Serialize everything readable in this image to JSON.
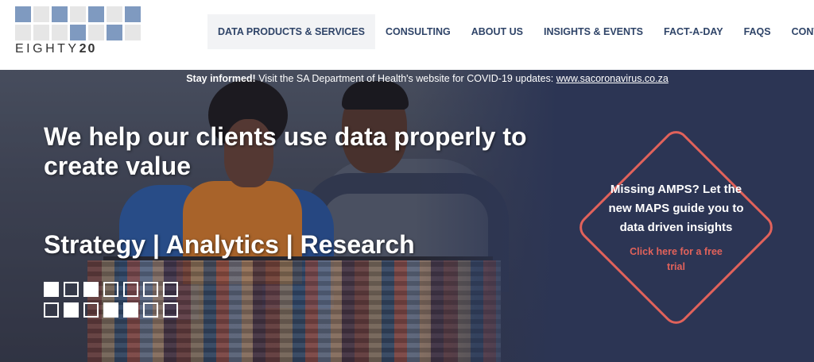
{
  "logo": {
    "word_light": "EIGHTY",
    "word_bold": "20",
    "grid_on": [
      0,
      2,
      4,
      6,
      10,
      12
    ]
  },
  "nav": {
    "items": [
      {
        "label": "DATA PRODUCTS & SERVICES",
        "active": true
      },
      {
        "label": "CONSULTING"
      },
      {
        "label": "ABOUT US"
      },
      {
        "label": "INSIGHTS & EVENTS"
      },
      {
        "label": "FACT-A-DAY"
      },
      {
        "label": "FAQS"
      },
      {
        "label": "CONTACT"
      }
    ]
  },
  "notice": {
    "lead": "Stay informed!",
    "text": " Visit the SA Department of Health's website for COVID-19 updates: ",
    "link": "www.sacoronavirus.co.za"
  },
  "hero": {
    "headline": "We help our clients use data properly to create value",
    "services": "Strategy | Analytics | Research",
    "squares_filled": [
      0,
      2,
      8,
      10,
      11
    ]
  },
  "cta": {
    "text": "Missing AMPS? Let the new MAPS guide you to data driven insights",
    "link": "Click here for a free trial"
  },
  "colors": {
    "nav_text": "#2f4468",
    "hero_bg": "#2c3554",
    "accent": "#e1625b",
    "logo_blue": "#7f9ac0"
  }
}
